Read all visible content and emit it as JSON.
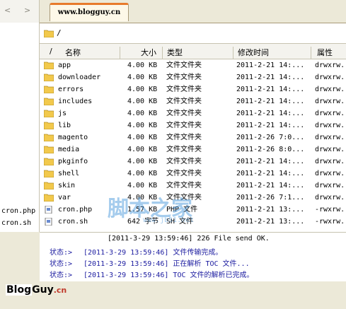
{
  "tab": {
    "title": "www.blogguy.cn"
  },
  "nav": {
    "back": "<",
    "forward": ">"
  },
  "path": {
    "value": "/"
  },
  "left_pane": {
    "items": [
      "",
      "",
      "",
      "",
      "",
      "",
      "",
      "",
      "",
      "",
      "",
      "",
      "",
      "",
      "",
      "cron.php",
      "cron.sh"
    ]
  },
  "columns": {
    "sort": "/",
    "name": "名称",
    "size": "大小",
    "type": "类型",
    "modified": "修改时间",
    "attr": "属性"
  },
  "files": [
    {
      "name": "app",
      "size": "4.00  KB",
      "type": "文件文件夹",
      "modified": "2011-2-21  14:...",
      "attr": "drwxrw..."
    },
    {
      "name": "downloader",
      "size": "4.00  KB",
      "type": "文件文件夹",
      "modified": "2011-2-21  14:...",
      "attr": "drwxrw..."
    },
    {
      "name": "errors",
      "size": "4.00  KB",
      "type": "文件文件夹",
      "modified": "2011-2-21  14:...",
      "attr": "drwxrw..."
    },
    {
      "name": "includes",
      "size": "4.00  KB",
      "type": "文件文件夹",
      "modified": "2011-2-21  14:...",
      "attr": "drwxrw..."
    },
    {
      "name": "js",
      "size": "4.00  KB",
      "type": "文件文件夹",
      "modified": "2011-2-21  14:...",
      "attr": "drwxrw..."
    },
    {
      "name": "lib",
      "size": "4.00  KB",
      "type": "文件文件夹",
      "modified": "2011-2-21  14:...",
      "attr": "drwxrw..."
    },
    {
      "name": "magento",
      "size": "4.00  KB",
      "type": "文件文件夹",
      "modified": "2011-2-26  7:0...",
      "attr": "drwxrw..."
    },
    {
      "name": "media",
      "size": "4.00  KB",
      "type": "文件文件夹",
      "modified": "2011-2-26  8:0...",
      "attr": "drwxrw..."
    },
    {
      "name": "pkginfo",
      "size": "4.00  KB",
      "type": "文件文件夹",
      "modified": "2011-2-21  14:...",
      "attr": "drwxrw..."
    },
    {
      "name": "shell",
      "size": "4.00  KB",
      "type": "文件文件夹",
      "modified": "2011-2-21  14:...",
      "attr": "drwxrw..."
    },
    {
      "name": "skin",
      "size": "4.00  KB",
      "type": "文件文件夹",
      "modified": "2011-2-21  14:...",
      "attr": "drwxrw..."
    },
    {
      "name": "var",
      "size": "4.00  KB",
      "type": "文件文件夹",
      "modified": "2011-2-26  7:1...",
      "attr": "drwxrw..."
    },
    {
      "name": "cron.php",
      "size": "1.57  KB",
      "type": "PHP 文件",
      "modified": "2011-2-21  13:...",
      "attr": "-rwxrw..."
    },
    {
      "name": "cron.sh",
      "size": "642  字节",
      "type": "SH 文件",
      "modified": "2011-2-21  13:...",
      "attr": "-rwxrw..."
    }
  ],
  "log": [
    {
      "label": "",
      "text": "[2011-3-29  13:59:46]  226 File send OK."
    },
    {
      "label": "状态:>",
      "text": "[2011-3-29  13:59:46]  文件传输完成。"
    },
    {
      "label": "状态:>",
      "text": "[2011-3-29  13:59:46]  正在解析 TOC 文件..."
    },
    {
      "label": "状态:>",
      "text": "[2011-3-29  13:59:46]  TOC 文件的解析已完成。"
    }
  ],
  "watermark": {
    "big": "脚本之家",
    "small": "www.jb51.net"
  },
  "logo": {
    "part1": "Blog",
    "part2": "Guy",
    "part3": ".cn"
  },
  "colors": {
    "accent": "#e77a2b",
    "log_text": "#1c1ca0",
    "folder": "#f2c94c"
  }
}
